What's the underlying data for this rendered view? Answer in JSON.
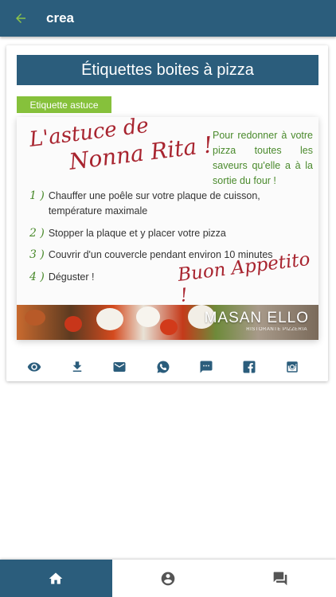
{
  "app": {
    "title": "crea"
  },
  "card": {
    "title": "Étiquettes boites à pizza",
    "tag": "Etiquette astuce",
    "tip": {
      "heading_line1": "L'astuce de",
      "heading_line2": "Nonna Rita !",
      "intro": "Pour redonner à votre pizza toutes les saveurs qu'elle a à la sortie du four !",
      "steps": [
        {
          "num": "1 )",
          "text": "Chauffer une poêle sur votre plaque de cuisson, température maximale"
        },
        {
          "num": "2 )",
          "text": "Stopper la plaque et y placer votre pizza"
        },
        {
          "num": "3 )",
          "text": "Couvrir d'un couvercle pendant environ 10 minutes"
        },
        {
          "num": "4 )",
          "text": "Déguster !"
        }
      ],
      "closing": "Buon Appetito !",
      "brand": "MASAN ELLO",
      "brand_sub": "RISTORANTE PIZZERIA"
    },
    "actions": [
      "eye-icon",
      "download-icon",
      "email-icon",
      "whatsapp-icon",
      "sms-icon",
      "facebook-icon",
      "instagram-icon"
    ]
  },
  "bottom_nav": {
    "items": [
      "home-icon",
      "account-icon",
      "messages-icon"
    ],
    "active_index": 0
  },
  "colors": {
    "primary": "#2b5d7c",
    "tag_green": "#86c13b",
    "accent_arrow": "#8bc34a",
    "tip_red": "#a8242f",
    "tip_green": "#4a8a2c"
  }
}
